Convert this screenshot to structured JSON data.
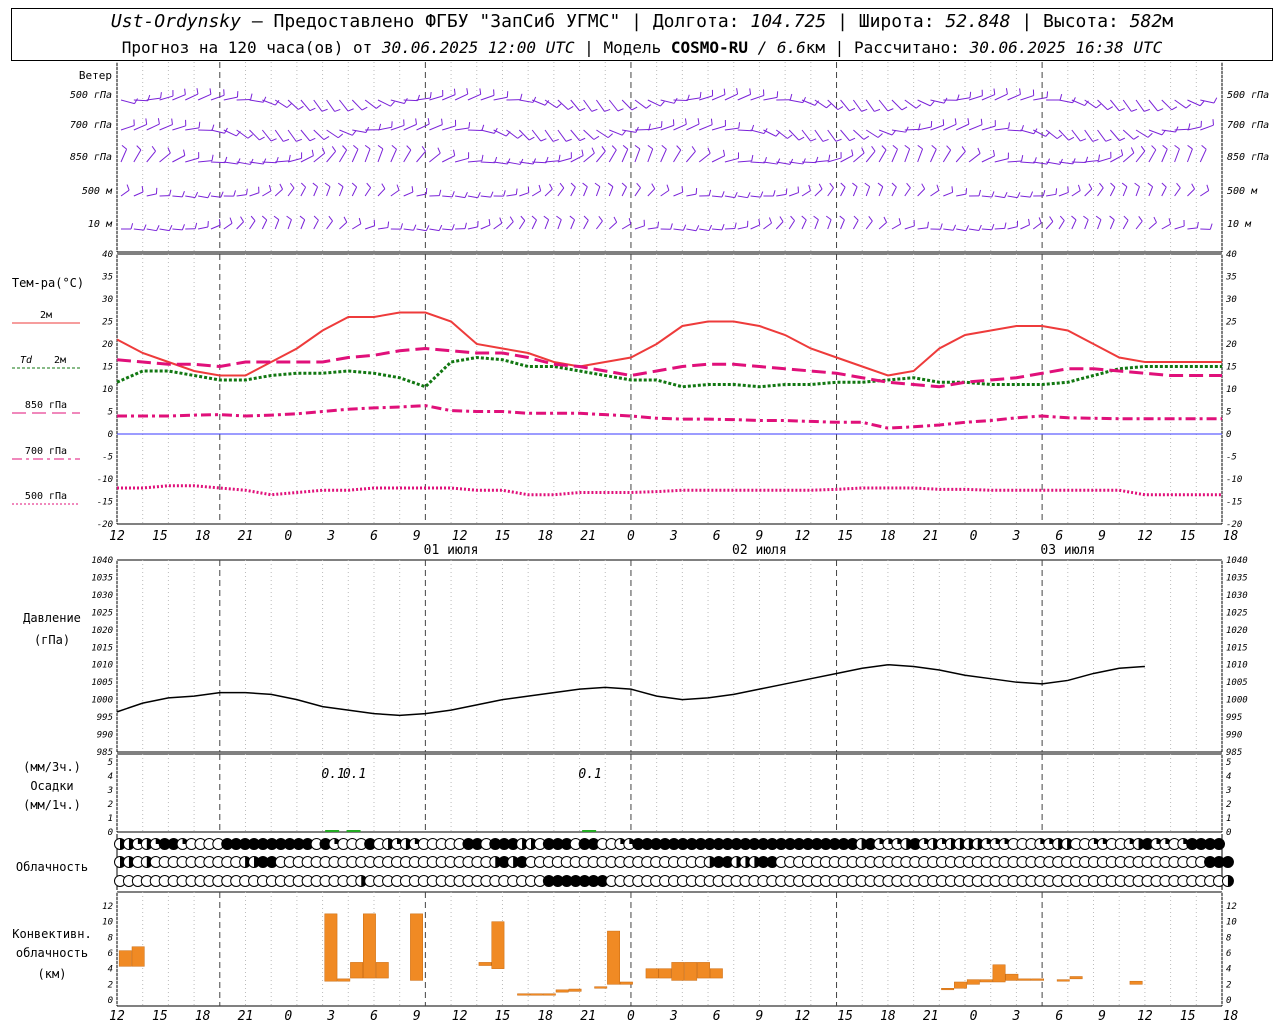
{
  "header": {
    "station": "Ust-Ordynsky",
    "dash": "—",
    "provider": "Предоставлено ФГБУ \"ЗапСиб УГМС\"",
    "lon_label": "Долгота:",
    "lon_value": "104.725",
    "lat_label": "Широта:",
    "lat_value": "52.848",
    "alt_label": "Высота:",
    "alt_value": "582",
    "alt_unit": "м",
    "sep": "|"
  },
  "subheader": {
    "forecast_prefix": "Прогноз на 120 часа(ов) от",
    "forecast_start": "30.06.2025 12:00 UTC",
    "model_label": "Модель",
    "model_name": "COSMO-RU",
    "model_res": "/ 6.6",
    "model_res_unit": "км",
    "calc_label": "Рассчитано:",
    "calc_time": "30.06.2025 16:38 UTC",
    "sep": "|"
  },
  "time_axis": {
    "tick_labels": [
      "12",
      "15",
      "18",
      "21",
      "0",
      "3",
      "6",
      "9",
      "12",
      "15",
      "18",
      "21",
      "0",
      "3",
      "6",
      "9",
      "12",
      "15",
      "18",
      "21",
      "0",
      "3",
      "6",
      "9",
      "12",
      "15",
      "18"
    ],
    "date_labels": [
      "01 июля",
      "02 июля",
      "03 июля"
    ]
  },
  "wind_panel": {
    "title": "Ветер",
    "levels": [
      "500 гПа",
      "700 гПа",
      "850 гПа",
      "500 м",
      "10 м"
    ]
  },
  "temp_panel": {
    "title": "Тем-ра(°C)",
    "legend": [
      {
        "label": "2м",
        "color": "#ee3b3b",
        "dash": "solid"
      },
      {
        "label": "Td",
        "label2": "2м",
        "color": "#117711",
        "dash": "dotted"
      },
      {
        "label": "850 гПа",
        "color": "#e0107a",
        "dash": "longdash"
      },
      {
        "label": "700 гПа",
        "color": "#e0107a",
        "dash": "dashdot"
      },
      {
        "label": "500 гПа",
        "color": "#e0107a",
        "dash": "dense"
      }
    ],
    "ticks": [
      "40",
      "35",
      "30",
      "25",
      "20",
      "15",
      "10",
      "5",
      "0",
      "-5",
      "-10",
      "-15",
      "-20"
    ]
  },
  "pressure_panel": {
    "title": "Давление",
    "unit": "(гПа)",
    "ticks": [
      "1040",
      "1035",
      "1030",
      "1025",
      "1020",
      "1015",
      "1010",
      "1005",
      "1000",
      "995",
      "990",
      "985"
    ]
  },
  "precip_panel": {
    "unit1": "(мм/3ч.)",
    "title": "Осадки",
    "unit2": "(мм/1ч.)",
    "ticks": [
      "5",
      "4",
      "3",
      "2",
      "1",
      "0"
    ],
    "labels": [
      "0.1",
      "0.1",
      "0.1"
    ]
  },
  "cloud_panel": {
    "title": "Облачность"
  },
  "conv_panel": {
    "title1": "Конвективн.",
    "title2": "облачность",
    "unit": "(км)",
    "ticks": [
      "12",
      "10",
      "8",
      "6",
      "4",
      "2",
      "0"
    ]
  },
  "colors": {
    "t2m": "#ee3b3b",
    "td": "#117711",
    "upper": "#e0107a",
    "wind": "#7a22d8",
    "conv": "#f08a24",
    "precip": "#22aa22",
    "zero_line": "#3a3aff"
  },
  "chart_data": [
    {
      "type": "line",
      "title": "Тем-ра(°C)",
      "x": [
        0,
        3,
        6,
        9,
        12,
        15,
        18,
        21,
        24,
        27,
        30,
        33,
        36,
        39,
        42,
        45,
        48,
        51,
        54,
        57,
        60,
        63,
        66,
        69,
        72,
        75,
        78,
        81,
        84,
        87,
        90,
        93,
        96,
        99,
        102,
        105,
        108,
        111,
        114,
        117,
        120,
        123,
        126,
        129
      ],
      "ylim": [
        -20,
        40
      ],
      "series": [
        {
          "name": "2м",
          "values": [
            21,
            18,
            16,
            14,
            13,
            13,
            16,
            19,
            23,
            26,
            26,
            27,
            27,
            25,
            20,
            19,
            18,
            16,
            15,
            16,
            17,
            20,
            24,
            25,
            25,
            24,
            22,
            19,
            17,
            15,
            13,
            14,
            19,
            22,
            23,
            24,
            24,
            23,
            20,
            17,
            16,
            16,
            16,
            16
          ]
        },
        {
          "name": "Td 2м",
          "values": [
            11.5,
            14,
            14,
            13,
            12,
            12,
            13,
            13.5,
            13.5,
            14,
            13.5,
            12.5,
            10.5,
            16,
            17,
            16.5,
            15,
            15,
            14,
            13,
            12,
            12,
            10.5,
            11,
            11,
            10.5,
            11,
            11,
            11.5,
            11.5,
            12,
            12.5,
            11.5,
            11.5,
            11,
            11,
            11,
            11.5,
            13,
            14.5,
            15,
            15,
            15,
            15
          ]
        },
        {
          "name": "850 гПа",
          "values": [
            16.5,
            16,
            15.5,
            15.5,
            15,
            16,
            16,
            16,
            16,
            17,
            17.5,
            18.5,
            19,
            18.5,
            18,
            18,
            17,
            15.5,
            15,
            14,
            13,
            14,
            15,
            15.5,
            15.5,
            15,
            14.5,
            14,
            13.5,
            12.5,
            11.5,
            11,
            10.5,
            11.5,
            12,
            12.5,
            13.5,
            14.5,
            14.5,
            14,
            13.5,
            13,
            13,
            13
          ]
        },
        {
          "name": "700 гПа",
          "values": [
            4,
            4,
            4,
            4.2,
            4.3,
            4,
            4.2,
            4.5,
            5,
            5.5,
            5.8,
            6,
            6.3,
            5.2,
            5,
            5,
            4.6,
            4.6,
            4.6,
            4.3,
            4,
            3.5,
            3.3,
            3.3,
            3.2,
            3,
            3,
            2.8,
            2.6,
            2.6,
            1.3,
            1.6,
            2,
            2.6,
            3,
            3.6,
            4,
            3.6,
            3.5,
            3.4,
            3.4,
            3.4,
            3.4,
            3.4
          ]
        },
        {
          "name": "500 гПа",
          "values": [
            -12,
            -12,
            -11.5,
            -11.5,
            -12,
            -12.5,
            -13.5,
            -13,
            -12.5,
            -12.5,
            -12,
            -12,
            -12,
            -12,
            -12.5,
            -12.5,
            -13.5,
            -13.5,
            -13,
            -13,
            -13,
            -12.8,
            -12.5,
            -12.5,
            -12.5,
            -12.5,
            -12.5,
            -12.5,
            -12.3,
            -12,
            -12,
            -12,
            -12.3,
            -12.3,
            -12.5,
            -12.5,
            -12.5,
            -12.5,
            -12.5,
            -12.5,
            -13.5,
            -13.5,
            -13.5,
            -13.5
          ]
        }
      ]
    },
    {
      "type": "line",
      "title": "Давление",
      "x": [
        0,
        3,
        6,
        9,
        12,
        15,
        18,
        21,
        24,
        27,
        30,
        33,
        36,
        39,
        42,
        45,
        48,
        51,
        54,
        57,
        60,
        63,
        66,
        69,
        72,
        75,
        78,
        81,
        84,
        87,
        90,
        93,
        96,
        99,
        102,
        105,
        108,
        111,
        114,
        117,
        120
      ],
      "ylim": [
        985,
        1040
      ],
      "series": [
        {
          "name": "Давление",
          "values": [
            996.5,
            999,
            1000.5,
            1001,
            1002,
            1002,
            1001.5,
            1000,
            998,
            997,
            996,
            995.5,
            996,
            997,
            998.5,
            1000,
            1001,
            1002,
            1003,
            1003.5,
            1003,
            1001,
            1000,
            1000.5,
            1001.5,
            1003,
            1004.5,
            1006,
            1007.5,
            1009,
            1010,
            1009.5,
            1008.5,
            1007,
            1006,
            1005,
            1004.5,
            1005.5,
            1007.5,
            1009,
            1009.5
          ]
        }
      ]
    },
    {
      "type": "bar",
      "title": "Конвективн. облачность",
      "ylim": [
        0,
        13
      ],
      "bars": [
        {
          "x": 1,
          "base": 4.3,
          "top": 6.3
        },
        {
          "x": 2.5,
          "base": 4.3,
          "top": 6.8
        },
        {
          "x": 25,
          "base": 2.4,
          "top": 11
        },
        {
          "x": 26.5,
          "base": 2.4,
          "top": 2.7
        },
        {
          "x": 28,
          "base": 2.8,
          "top": 4.8
        },
        {
          "x": 29.5,
          "base": 2.8,
          "top": 11
        },
        {
          "x": 31,
          "base": 2.8,
          "top": 4.8
        },
        {
          "x": 35,
          "base": 2.5,
          "top": 11
        },
        {
          "x": 43,
          "base": 4.4,
          "top": 4.8
        },
        {
          "x": 44.5,
          "base": 4,
          "top": 10
        },
        {
          "x": 47.5,
          "base": 0.7,
          "top": 0.8
        },
        {
          "x": 49,
          "base": 0.7,
          "top": 0.8
        },
        {
          "x": 50.5,
          "base": 0.7,
          "top": 0.8
        },
        {
          "x": 52,
          "base": 1,
          "top": 1.3
        },
        {
          "x": 53.5,
          "base": 1.1,
          "top": 1.4
        },
        {
          "x": 56.5,
          "base": 1.5,
          "top": 1.7
        },
        {
          "x": 58,
          "base": 2,
          "top": 8.8
        },
        {
          "x": 59.5,
          "base": 2,
          "top": 2.3
        },
        {
          "x": 62.5,
          "base": 2.8,
          "top": 4
        },
        {
          "x": 64,
          "base": 2.8,
          "top": 4
        },
        {
          "x": 65.5,
          "base": 2.5,
          "top": 4.8
        },
        {
          "x": 67,
          "base": 2.5,
          "top": 4.8
        },
        {
          "x": 68.5,
          "base": 2.8,
          "top": 4.8
        },
        {
          "x": 70,
          "base": 2.8,
          "top": 4
        },
        {
          "x": 97,
          "base": 1.3,
          "top": 1.5
        },
        {
          "x": 98.5,
          "base": 1.5,
          "top": 2.3
        },
        {
          "x": 100,
          "base": 2,
          "top": 2.6
        },
        {
          "x": 101.5,
          "base": 2.3,
          "top": 2.6
        },
        {
          "x": 103,
          "base": 2.3,
          "top": 4.5
        },
        {
          "x": 104.5,
          "base": 2.5,
          "top": 3.3
        },
        {
          "x": 106,
          "base": 2.5,
          "top": 2.7
        },
        {
          "x": 107.5,
          "base": 2.5,
          "top": 2.7
        },
        {
          "x": 110.5,
          "base": 2.4,
          "top": 2.6
        },
        {
          "x": 112,
          "base": 2.7,
          "top": 3
        },
        {
          "x": 119,
          "base": 2,
          "top": 2.4
        }
      ]
    },
    {
      "type": "bar",
      "title": "Осадки",
      "ylim": [
        0,
        5
      ],
      "bars": [
        {
          "x": 25,
          "value": 0.1
        },
        {
          "x": 27.5,
          "value": 0.1
        },
        {
          "x": 55,
          "value": 0.1
        }
      ]
    },
    {
      "type": "table",
      "title": "Облачность",
      "rows": [
        [
          2,
          2,
          1,
          2,
          1,
          3,
          3,
          1,
          0,
          0,
          0,
          0,
          3,
          3,
          3,
          3,
          3,
          3,
          3,
          3,
          3,
          3,
          0,
          3,
          1,
          0,
          0,
          0,
          3,
          0,
          2,
          1,
          2,
          1,
          0,
          0,
          0,
          0,
          0,
          3,
          3,
          0,
          3,
          3,
          3,
          2,
          2,
          0,
          3,
          3,
          3,
          0,
          3,
          3,
          0,
          0,
          1,
          1,
          3,
          3,
          3,
          3,
          3,
          3,
          3,
          3,
          3,
          3,
          3,
          3,
          3,
          3,
          3,
          3,
          3,
          3,
          3,
          3,
          3,
          3,
          3,
          3,
          3,
          2,
          3,
          1,
          1,
          1,
          2,
          3,
          1,
          2,
          1,
          2,
          2,
          2,
          2,
          1,
          1,
          1,
          0,
          0,
          0,
          1,
          1,
          2,
          2,
          0,
          0,
          1,
          1,
          0,
          0,
          1,
          2,
          3,
          1,
          1,
          0,
          1,
          3,
          3,
          3,
          3
        ],
        [
          2,
          2,
          0,
          2,
          0,
          0,
          0,
          0,
          0,
          0,
          0,
          0,
          0,
          0,
          2,
          2,
          3,
          3,
          0,
          0,
          0,
          0,
          0,
          0,
          0,
          0,
          0,
          0,
          0,
          0,
          0,
          0,
          0,
          0,
          0,
          0,
          0,
          0,
          0,
          0,
          0,
          0,
          2,
          3,
          2,
          3,
          0,
          0,
          0,
          0,
          0,
          0,
          0,
          0,
          0,
          0,
          0,
          0,
          0,
          0,
          0,
          0,
          0,
          0,
          0,
          0,
          2,
          3,
          3,
          2,
          2,
          2,
          3,
          3,
          0,
          0,
          0,
          0,
          0,
          0,
          0,
          0,
          0,
          0,
          0,
          0,
          0,
          0,
          0,
          0,
          0,
          0,
          0,
          0,
          0,
          0,
          0,
          0,
          0,
          0,
          0,
          0,
          0,
          0,
          0,
          0,
          0,
          0,
          0,
          0,
          0,
          0,
          0,
          0,
          0,
          0,
          0,
          0,
          0,
          0,
          0,
          0,
          3,
          3,
          3
        ],
        [
          0,
          0,
          0,
          0,
          0,
          0,
          0,
          0,
          0,
          0,
          0,
          0,
          0,
          0,
          0,
          0,
          0,
          0,
          0,
          0,
          0,
          0,
          0,
          0,
          0,
          0,
          0,
          2,
          0,
          0,
          0,
          0,
          0,
          0,
          0,
          0,
          0,
          0,
          0,
          0,
          0,
          0,
          0,
          0,
          0,
          0,
          0,
          0,
          3,
          3,
          3,
          3,
          3,
          3,
          3,
          0,
          0,
          0,
          0,
          0,
          0,
          0,
          0,
          0,
          0,
          0,
          0,
          0,
          0,
          0,
          0,
          0,
          0,
          0,
          0,
          0,
          0,
          0,
          0,
          0,
          0,
          0,
          0,
          0,
          0,
          0,
          0,
          0,
          0,
          0,
          0,
          0,
          0,
          0,
          0,
          0,
          0,
          0,
          0,
          0,
          0,
          0,
          0,
          0,
          0,
          0,
          0,
          0,
          0,
          0,
          0,
          0,
          0,
          0,
          0,
          0,
          0,
          0,
          0,
          0,
          0,
          0,
          0,
          0,
          2
        ]
      ]
    }
  ]
}
